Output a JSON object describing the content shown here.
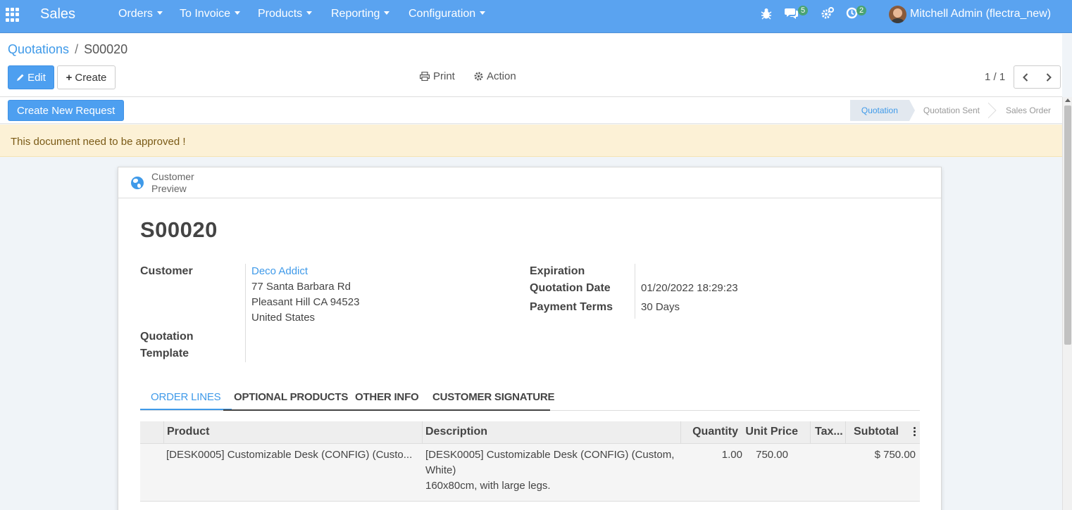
{
  "navbar": {
    "brand": "Sales",
    "menus": [
      "Orders",
      "To Invoice",
      "Products",
      "Reporting",
      "Configuration"
    ],
    "messages_count": "5",
    "activities_count": "2",
    "user": "Mitchell Admin (flectra_new)"
  },
  "breadcrumb": {
    "parent": "Quotations",
    "separator": "/",
    "current": "S00020"
  },
  "toolbar": {
    "edit_label": "Edit",
    "create_label": "Create",
    "print_label": "Print",
    "action_label": "Action",
    "pager_value": "1 / 1"
  },
  "statusbar": {
    "create_request_label": "Create New Request",
    "stages": [
      "Quotation",
      "Quotation Sent",
      "Sales Order"
    ],
    "active_stage": "Quotation"
  },
  "alert": {
    "text": "This document need to be approved !"
  },
  "smart_button": {
    "line1": "Customer",
    "line2": "Preview"
  },
  "form": {
    "name": "S00020",
    "customer_label": "Customer",
    "customer_name": "Deco Addict",
    "address_line1": "77 Santa Barbara Rd",
    "address_line2": "Pleasant Hill CA 94523",
    "address_line3": "United States",
    "template_label_1": "Quotation",
    "template_label_2": "Template",
    "expiration_label": "Expiration",
    "quotation_date_label": "Quotation Date",
    "quotation_date": "01/20/2022 18:29:23",
    "payment_terms_label": "Payment Terms",
    "payment_terms": "30 Days"
  },
  "tabs": [
    "ORDER LINES",
    "OPTIONAL PRODUCTS",
    "OTHER INFO",
    "CUSTOMER SIGNATURE"
  ],
  "order_lines": {
    "columns": [
      "Product",
      "Description",
      "Quantity",
      "Unit Price",
      "Tax...",
      "Subtotal"
    ],
    "rows": [
      {
        "product": "[DESK0005] Customizable Desk (CONFIG) (Custo...",
        "description_line1": "[DESK0005] Customizable Desk (CONFIG) (Custom,",
        "description_line2": "White)",
        "description_line3": "160x80cm, with large legs.",
        "quantity": "1.00",
        "unit_price": "750.00",
        "taxes": "",
        "subtotal": "$ 750.00"
      }
    ]
  },
  "colors": {
    "navbar": "#5aa3f0",
    "primary": "#4d9ff0",
    "link": "#3f9ae9",
    "alert_bg": "#fcf1d6",
    "badge": "#4aa374"
  }
}
